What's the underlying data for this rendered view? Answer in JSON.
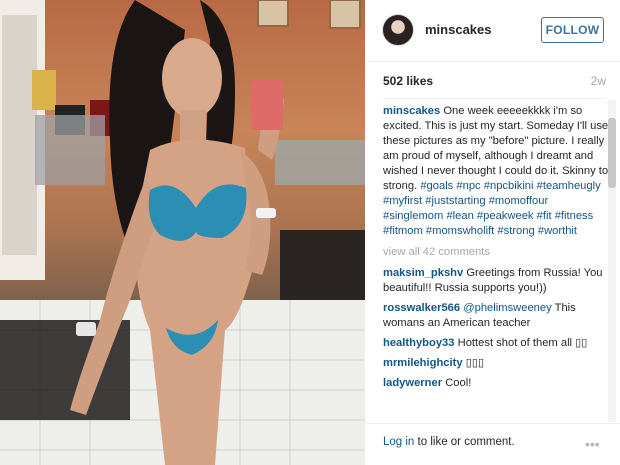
{
  "post": {
    "username": "minscakes",
    "follow_label": "FOLLOW",
    "likes": "502 likes",
    "age": "2w"
  },
  "caption": {
    "author": "minscakes",
    "text": "One week eeeeekkkk i'm so excited. This is just my start. Someday I'll use these pictures as my \"before\" picture. I really am proud of myself, although I dreamt and wished I never thought I could do it. Skinny to strong.",
    "hashtags": [
      "#goals",
      "#npc",
      "#npcbikini",
      "#teamheugly",
      "#myfirst",
      "#juststarting",
      "#momoffour",
      "#singlemom",
      "#lean",
      "#peakweek",
      "#fit",
      "#fitness",
      "#fitmom",
      "#momswholift",
      "#strong",
      "#worthit"
    ]
  },
  "view_all": "view all 42 comments",
  "comments": [
    {
      "author": "maksim_pkshv",
      "text": "Greetings from Russia! You beautiful!! Russia supports you!))"
    },
    {
      "author": "rosswalker566",
      "mention": "@phelimsweeney",
      "text": "This womans an American teacher"
    },
    {
      "author": "healthyboy33",
      "text": "Hottest shot of them all ▯▯"
    },
    {
      "author": "mrmilehighcity",
      "text": "▯▯▯"
    },
    {
      "author": "ladywerner",
      "text": "Cool!"
    }
  ],
  "footer": {
    "login_link": "Log in",
    "login_rest": "to like or comment.",
    "more_icon": "more-options-icon",
    "more_glyph": "•••"
  },
  "colors": {
    "link": "#125688",
    "follow": "#3f729b",
    "muted": "#a5a7aa"
  }
}
